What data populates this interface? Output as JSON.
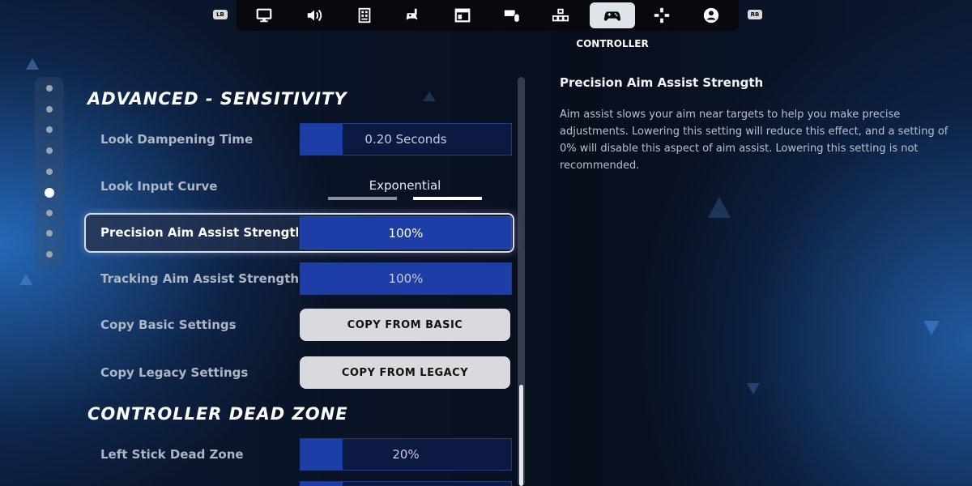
{
  "nav": {
    "left_bumper": "LB",
    "right_bumper": "RB",
    "tabs": [
      {
        "icon": "monitor-icon"
      },
      {
        "icon": "speaker-icon"
      },
      {
        "icon": "grid-icon"
      },
      {
        "icon": "controller-touch-icon"
      },
      {
        "icon": "window-icon"
      },
      {
        "icon": "keyboard-mouse-icon"
      },
      {
        "icon": "keyboard-icon"
      },
      {
        "icon": "gamepad-icon",
        "active": true
      },
      {
        "icon": "dpad-icon"
      },
      {
        "icon": "account-icon"
      }
    ],
    "active_caption": "CONTROLLER"
  },
  "rail": {
    "dot_count": 9,
    "active_index": 5
  },
  "sections": [
    {
      "title": "ADVANCED - SENSITIVITY"
    },
    {
      "title": "CONTROLLER DEAD ZONE"
    }
  ],
  "settings": {
    "look_dampening": {
      "label": "Look Dampening Time",
      "value": "0.20 Seconds",
      "fill": 0.2
    },
    "look_input_curve": {
      "label": "Look Input Curve",
      "value": "Exponential",
      "selected_option_index": 1,
      "option_count": 2
    },
    "precision_aim": {
      "label": "Precision Aim Assist Strength",
      "value": "100%",
      "fill": 1.0
    },
    "tracking_aim": {
      "label": "Tracking Aim Assist Strength",
      "value": "100%",
      "fill": 1.0
    },
    "copy_basic": {
      "label": "Copy Basic Settings",
      "button": "COPY FROM BASIC"
    },
    "copy_legacy": {
      "label": "Copy Legacy Settings",
      "button": "COPY FROM LEGACY"
    },
    "left_stick_dead_zone": {
      "label": "Left Stick Dead Zone",
      "value": "20%",
      "fill": 0.2
    }
  },
  "description": {
    "title": "Precision Aim Assist Strength",
    "body": "Aim assist slows your aim near targets to help you make precise adjustments.  Lowering this setting will reduce this effect, and a setting of 0% will disable this aspect of aim assist. Lowering this setting is not recommended."
  },
  "colors": {
    "accent": "#1d3ea6",
    "slider_bg": "#0c1940",
    "button_bg": "#d8dade"
  }
}
